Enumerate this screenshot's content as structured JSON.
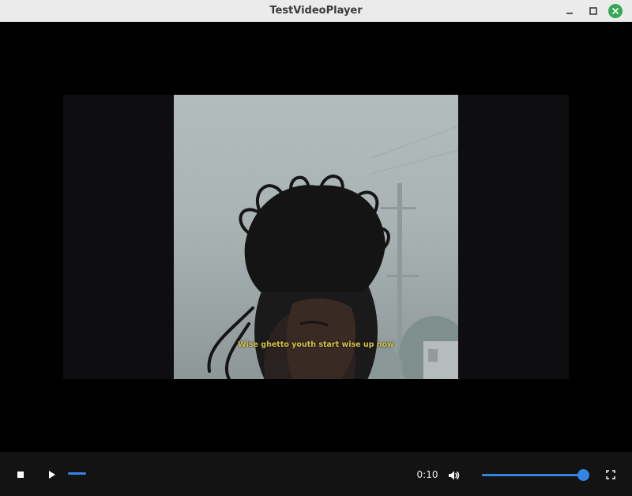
{
  "window": {
    "title": "TestVideoPlayer",
    "buttons": [
      "minimize-icon",
      "maximize-icon",
      "close-icon"
    ],
    "close_color": "#35a854"
  },
  "video": {
    "subtitle": "Wise ghetto youth start wise up now"
  },
  "controls": {
    "stop_icon": "stop-icon",
    "play_icon": "play-icon",
    "progress_fraction": 0.055,
    "time": "0:10",
    "volume_icon": "volume-high-icon",
    "volume_fraction": 1.0,
    "fullscreen_icon": "fullscreen-icon",
    "accent_color": "#3584e4"
  }
}
